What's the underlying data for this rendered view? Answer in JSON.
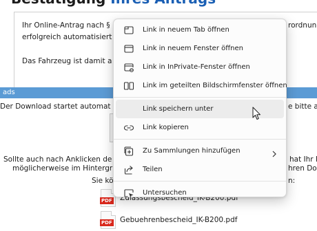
{
  "page": {
    "heading_prefix": "Bestätigung",
    "heading_highlight": "Ihres Antrags",
    "para1_line1": "Ihr Online-Antrag nach §",
    "para1_line1_right": "rordnun",
    "para1_line2": "erfolgreich automatisiert",
    "para2": "Das Fahrzeug ist damit a",
    "section_title": "ads",
    "download_line_left": "Der Download startet automat",
    "download_line_right": "e bitte a",
    "notice_line1_left": "Sollte auch nach Anklicken de",
    "notice_line1_right": "hat Ihr B",
    "notice_line2_left": "möglicherweise im Hintergr",
    "notice_line2_right": "hren Dov",
    "notice_line3_left": "Sie kö",
    "notice_line3_right": "n:",
    "pdf_tag": "PDF",
    "files": [
      {
        "name": "Zulassungsbescheid_IK-B200.pdf"
      },
      {
        "name": "Gebuehrenbescheid_IK-B200.pdf"
      }
    ]
  },
  "context_menu": {
    "items": [
      {
        "label": "Link in neuem Tab öffnen",
        "icon": "new-tab-icon"
      },
      {
        "label": "Link in neuem Fenster öffnen",
        "icon": "new-window-icon"
      },
      {
        "label": "Link in InPrivate-Fenster öffnen",
        "icon": "inprivate-window-icon"
      },
      {
        "label": "Link im geteilten Bildschirmfenster öffnen",
        "icon": "split-screen-icon"
      },
      {
        "label": "Link speichern unter",
        "icon": ""
      },
      {
        "label": "Link kopieren",
        "icon": "link-icon"
      },
      {
        "label": "Zu Sammlungen hinzufügen",
        "icon": "collections-icon",
        "submenu": true
      },
      {
        "label": "Teilen",
        "icon": "share-icon"
      },
      {
        "label": "Untersuchen",
        "icon": "inspect-icon"
      }
    ],
    "hovered_item": "Link speichern unter"
  },
  "colors": {
    "section_bar": "#5b9bd5",
    "pdf_red": "#d9281c",
    "menu_hover": "#ececec"
  }
}
